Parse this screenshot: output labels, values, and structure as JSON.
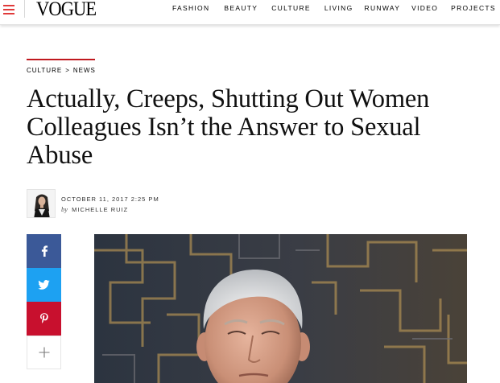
{
  "header": {
    "logo": "VOGUE",
    "nav": [
      "FASHION",
      "BEAUTY",
      "CULTURE",
      "LIVING",
      "RUNWAY",
      "VIDEO",
      "PROJECTS"
    ]
  },
  "breadcrumb": {
    "section": "CULTURE",
    "separator": ">",
    "subsection": "NEWS"
  },
  "article": {
    "headline": "Actually, Creeps, Shutting Out Women Colleagues Isn’t the Answer to Sexual Abuse",
    "date": "OCTOBER 11, 2017 2:25 PM",
    "by": "by",
    "author": "MICHELLE RUIZ"
  },
  "share": [
    {
      "network": "facebook",
      "icon": "facebook-icon",
      "color": "#3b5998"
    },
    {
      "network": "twitter",
      "icon": "twitter-icon",
      "color": "#1da1f2"
    },
    {
      "network": "pinterest",
      "icon": "pinterest-icon",
      "color": "#c8102e"
    },
    {
      "network": "more",
      "icon": "plus-icon",
      "color": "#ffffff"
    }
  ],
  "colors": {
    "accent": "#c0191f",
    "menu_icon": "#e03a3a"
  }
}
